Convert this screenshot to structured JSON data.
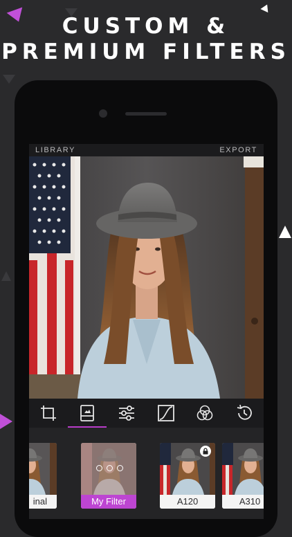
{
  "headline": {
    "line1": "CUSTOM &",
    "line2": "PREMIUM FILTERS"
  },
  "app": {
    "top_bar": {
      "left_label": "LIBRARY",
      "right_label": "EXPORT"
    },
    "toolbar": {
      "tools": [
        "crop-icon",
        "filters-icon",
        "adjust-sliders-icon",
        "curves-icon",
        "color-mix-icon",
        "history-icon"
      ],
      "active_tool": "filters-icon",
      "accent_color": "#b93cc9"
    },
    "filters": [
      {
        "label": "Original",
        "visible_label": "inal"
      },
      {
        "label": "My Filter",
        "selected": true
      },
      {
        "label": "A120",
        "locked": true
      },
      {
        "label": "A310"
      }
    ]
  },
  "colors": {
    "background": "#2a2a2c",
    "accent": "#bd45d2",
    "phone_body": "#0b0b0c"
  }
}
